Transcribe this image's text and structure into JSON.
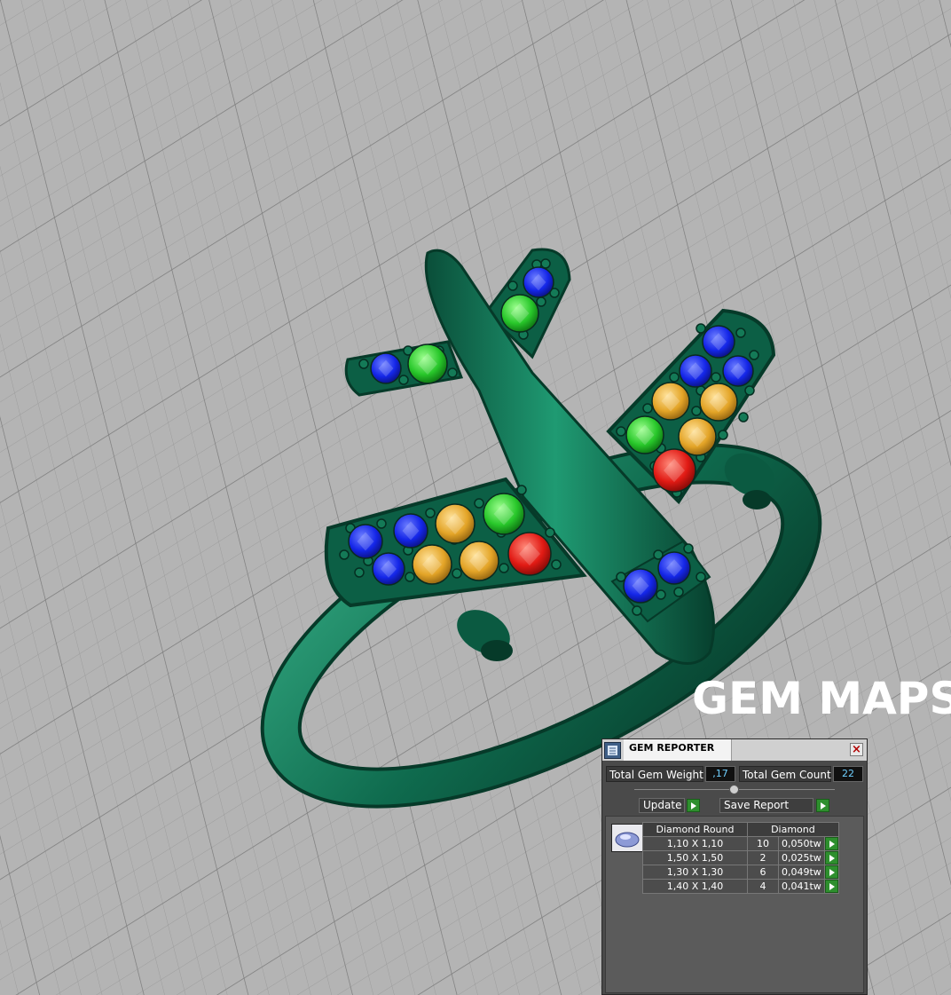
{
  "overlay_title": "GEM MAPS",
  "scene": {
    "description_icon": "airplane-ring-3d-model",
    "metal_color": "#0f6b4e",
    "background_color": "#b4b4b4",
    "grid_color": "#8f8f8f",
    "gem_colors": {
      "blue": "#1426e8",
      "green": "#28c72a",
      "yellow": "#e3a427",
      "red": "#e11a14"
    }
  },
  "gem_reporter": {
    "title": "GEM REPORTER",
    "total_weight_label": "Total Gem Weight",
    "total_weight_value": ",17",
    "total_count_label": "Total Gem Count",
    "total_count_value": "22",
    "update_label": "Update",
    "save_report_label": "Save Report",
    "close_icon": "close-icon",
    "table": {
      "headers": [
        "Diamond Round",
        "Diamond"
      ],
      "rows": [
        {
          "size": "1,10 X 1,10",
          "count": "10",
          "weight": "0,050tw"
        },
        {
          "size": "1,50 X 1,50",
          "count": "2",
          "weight": "0,025tw"
        },
        {
          "size": "1,30 X 1,30",
          "count": "6",
          "weight": "0,049tw"
        },
        {
          "size": "1,40 X 1,40",
          "count": "4",
          "weight": "0,041tw"
        }
      ]
    }
  }
}
